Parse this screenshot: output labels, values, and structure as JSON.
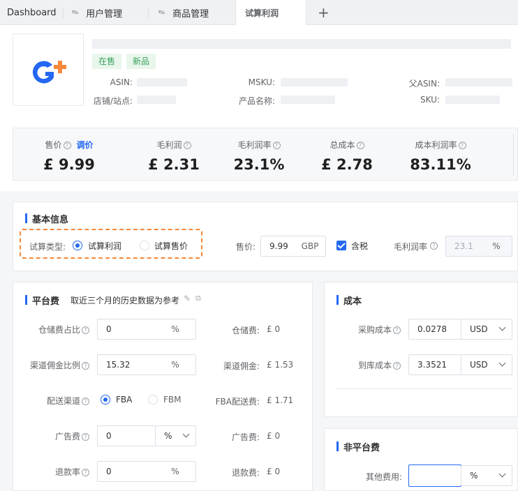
{
  "tabs": [
    {
      "label": "Dashboard"
    },
    {
      "label": "用户管理"
    },
    {
      "label": "商品管理"
    },
    {
      "label": "试算利润"
    }
  ],
  "product": {
    "tags": [
      "在售",
      "新品"
    ],
    "fields": {
      "asin": "ASIN:",
      "msku": "MSKU:",
      "parent_asin": "父ASIN:",
      "store": "店铺/站点:",
      "name": "产品名称:",
      "sku": "SKU:"
    }
  },
  "metrics": {
    "price": {
      "label": "售价",
      "action": "调价",
      "value": "£ 9.99"
    },
    "gross_profit": {
      "label": "毛利润",
      "value": "£ 2.31"
    },
    "gross_margin": {
      "label": "毛利润率",
      "value": "23.1%"
    },
    "total_cost": {
      "label": "总成本",
      "value": "£ 2.78"
    },
    "cost_margin": {
      "label": "成本利润率",
      "value": "83.11%"
    }
  },
  "basic": {
    "title": "基本信息",
    "type_label": "试算类型:",
    "type_options": [
      "试算利润",
      "试算售价"
    ],
    "price_label": "售价:",
    "price_value": "9.99",
    "price_currency": "GBP",
    "tax_label": "含税",
    "margin_label": "毛利润率",
    "margin_value": "23.1",
    "margin_unit": "%"
  },
  "platform": {
    "title": "平台费",
    "note": "取近三个月的历史数据为参考",
    "storage_ratio_label": "仓储费占比",
    "storage_ratio_value": "0",
    "storage_ratio_unit": "%",
    "storage_fee_label": "仓储费:",
    "storage_fee_value": "£ 0",
    "commission_ratio_label": "渠道佣金比例",
    "commission_ratio_value": "15.32",
    "commission_ratio_unit": "%",
    "commission_label": "渠道佣金:",
    "commission_value": "£ 1.53",
    "channel_label": "配送渠道",
    "channel_options": [
      "FBA",
      "FBM"
    ],
    "fba_fee_label": "FBA配送费:",
    "fba_fee_value": "£ 1.71",
    "ad_label": "广告费",
    "ad_value": "0",
    "ad_unit": "%",
    "ad_fee_label": "广告费:",
    "ad_fee_value": "£ 0",
    "refund_label": "退款率",
    "refund_value": "0",
    "refund_unit": "%",
    "refund_fee_label": "退款费:",
    "refund_fee_value": "£ 0"
  },
  "cost": {
    "title": "成本",
    "purchase_label": "采购成本",
    "purchase_value": "0.0278",
    "purchase_currency": "USD",
    "landed_label": "到库成本",
    "landed_value": "3.3521",
    "landed_currency": "USD"
  },
  "nonplatform": {
    "title": "非平台费",
    "other_label": "其他费用:",
    "other_value": "",
    "other_unit": "%"
  },
  "colors": {
    "accent": "#2468f2",
    "highlight": "#f5883a",
    "tag_green": "#3aa15a"
  }
}
